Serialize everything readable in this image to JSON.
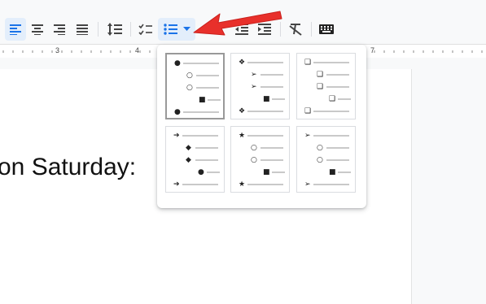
{
  "toolbar": {
    "buttons": [
      {
        "name": "align-left-icon",
        "active": true
      },
      {
        "name": "align-center-icon"
      },
      {
        "name": "align-right-icon"
      },
      {
        "name": "align-justify-icon"
      },
      {
        "name": "line-spacing-icon"
      },
      {
        "name": "checklist-icon"
      },
      {
        "name": "bulleted-list-icon",
        "active": true
      },
      {
        "name": "dropdown-caret-icon"
      },
      {
        "name": "decrease-indent-icon"
      },
      {
        "name": "increase-indent-icon"
      },
      {
        "name": "clear-formatting-icon"
      },
      {
        "name": "keyboard-icon"
      }
    ]
  },
  "ruler": {
    "marks": [
      "3",
      "4",
      "7"
    ]
  },
  "document": {
    "text": "on Saturday:"
  },
  "bullet_presets": [
    {
      "glyphs": [
        "●",
        "○",
        "○",
        "■",
        "●"
      ]
    },
    {
      "glyphs": [
        "❖",
        "➢",
        "➢",
        "■",
        "❖"
      ]
    },
    {
      "glyphs": [
        "❑",
        "❑",
        "❑",
        "❑",
        "❑"
      ]
    },
    {
      "glyphs": [
        "➔",
        "◆",
        "◆",
        "●",
        "➔"
      ]
    },
    {
      "glyphs": [
        "★",
        "○",
        "○",
        "■",
        "★"
      ]
    },
    {
      "glyphs": [
        "➢",
        "○",
        "○",
        "■",
        "➢"
      ]
    }
  ],
  "colors": {
    "accent": "#1a73e8",
    "arrow": "#e8302b"
  }
}
